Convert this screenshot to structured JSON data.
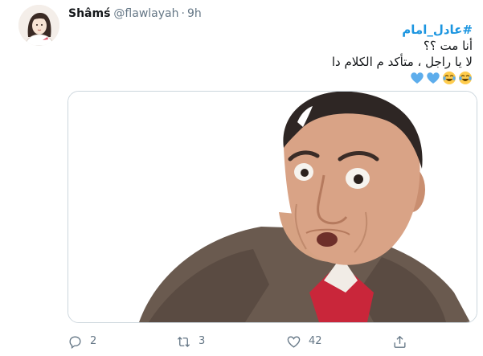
{
  "tweet": {
    "display_name": "Shâmś",
    "handle": "@flawlayah",
    "separator": "·",
    "time": "9h",
    "hashtag": "#عادل_امام",
    "line_1": "أنا مت ؟؟",
    "line_2": "لا يا راجل ، متأكد م الكلام دا",
    "emojis": [
      "joy",
      "joy",
      "blue-heart",
      "blue-heart"
    ]
  },
  "actions": {
    "reply": {
      "icon": "reply-icon",
      "count": "2"
    },
    "retweet": {
      "icon": "retweet-icon",
      "count": "3"
    },
    "like": {
      "icon": "heart-icon",
      "count": "42"
    },
    "share": {
      "icon": "share-icon"
    }
  },
  "colors": {
    "accent": "#1b95e0",
    "muted": "#657786",
    "text": "#14171a",
    "border": "#ccd6dd"
  }
}
